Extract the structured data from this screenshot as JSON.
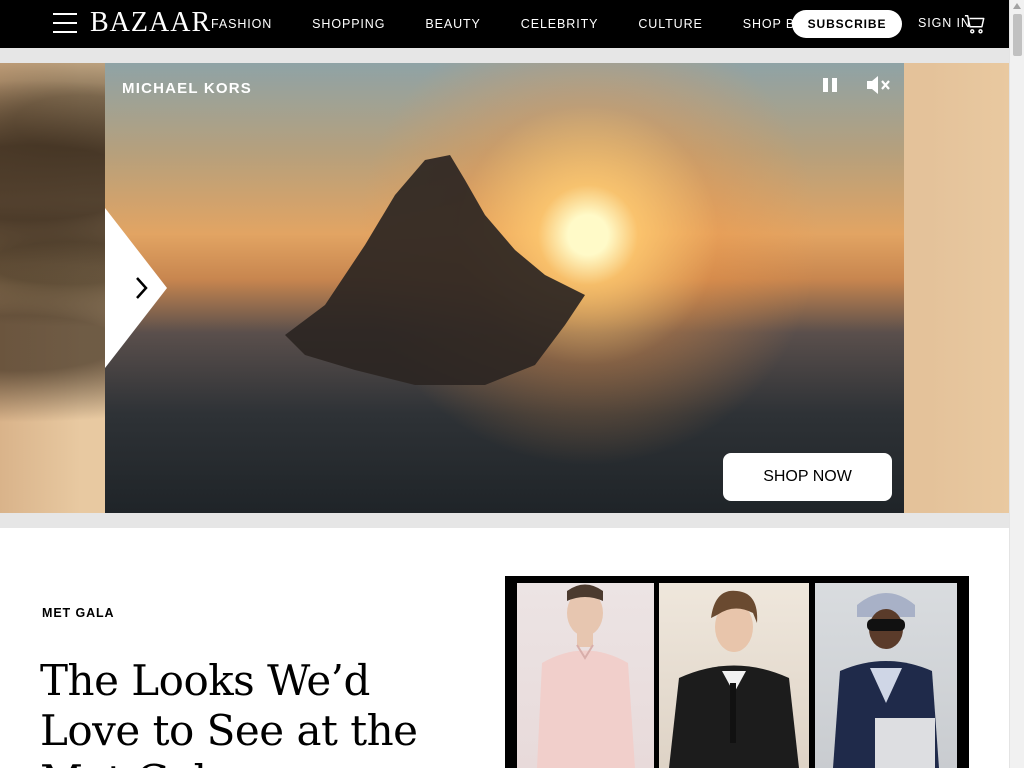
{
  "header": {
    "logo": "BAZAAR",
    "nav": [
      "FASHION",
      "SHOPPING",
      "BEAUTY",
      "CELEBRITY",
      "CULTURE",
      "SHOP BAZAAR"
    ],
    "subscribe_label": "SUBSCRIBE",
    "signin_label": "SIGN IN",
    "menu_icon": "hamburger-menu-icon",
    "cart_icon": "shopping-cart-icon"
  },
  "ad": {
    "brand": "MICHAEL KORS",
    "cta": "SHOP NOW",
    "pause_icon": "pause-icon",
    "mute_icon": "muted-speaker-icon",
    "next_icon": "chevron-right-icon"
  },
  "article": {
    "kicker": "MET GALA",
    "headline": "The Looks We’d Love to See at the Met Gala"
  },
  "colors": {
    "header_bg": "#000000",
    "header_text": "#ffffff",
    "band_gray": "#e6e6e6"
  }
}
